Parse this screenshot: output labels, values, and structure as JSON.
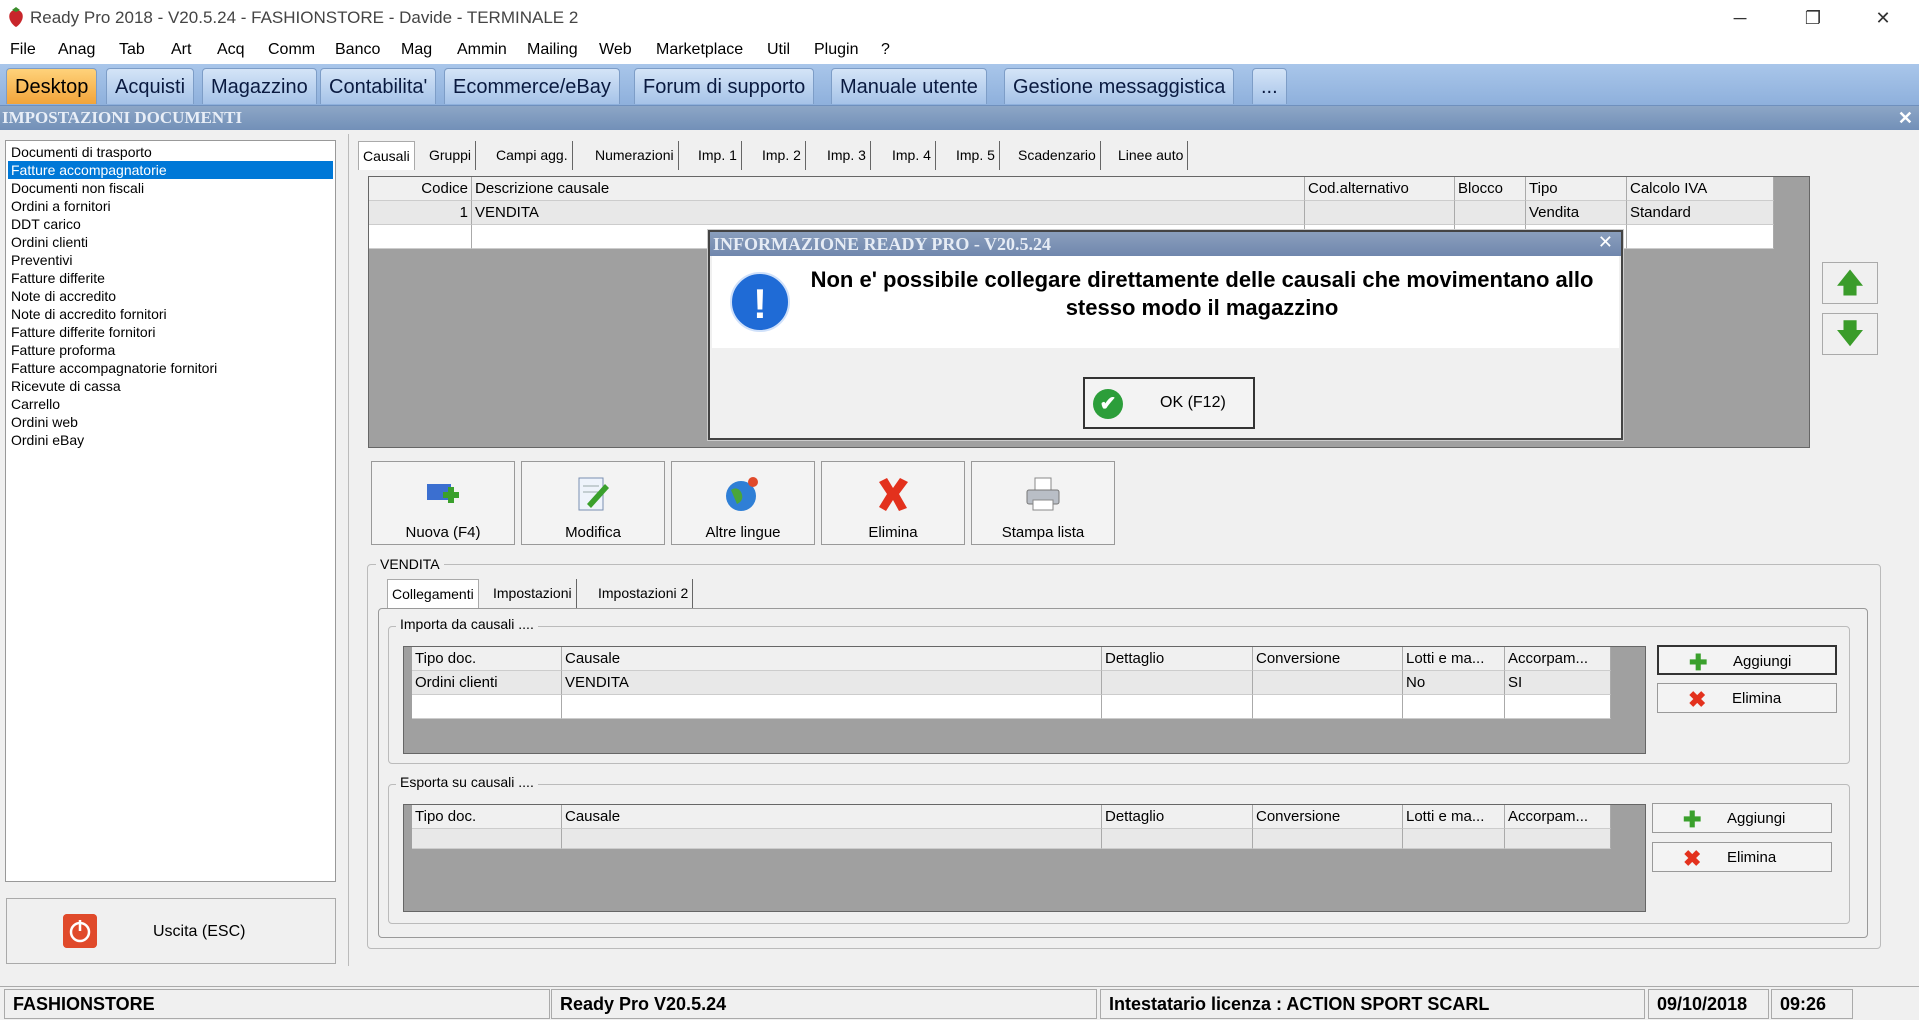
{
  "window": {
    "title": "Ready Pro 2018 - V20.5.24 - FASHIONSTORE - Davide - TERMINALE 2",
    "minimize_glyph": "─",
    "restore_glyph": "❐",
    "close_glyph": "✕"
  },
  "menu": [
    "File",
    "Anag",
    "Tab",
    "Art",
    "Acq",
    "Comm",
    "Banco",
    "Mag",
    "Ammin",
    "Mailing",
    "Web",
    "Marketplace",
    "Util",
    "Plugin",
    "?"
  ],
  "top_tabs": [
    "Desktop",
    "Acquisti",
    "Magazzino",
    "Contabilita'",
    "Ecommerce/eBay",
    "Forum di supporto",
    "Manuale utente",
    "Gestione messaggistica",
    "..."
  ],
  "section_title": "IMPOSTAZIONI DOCUMENTI",
  "section_close": "✕",
  "doc_types": [
    "Documenti di trasporto",
    "Fatture accompagnatorie",
    "Documenti non fiscali",
    "Ordini a fornitori",
    "DDT carico",
    "Ordini clienti",
    "Preventivi",
    "Fatture differite",
    "Note di accredito",
    "Note di accredito fornitori",
    "Fatture differite fornitori",
    "Fatture proforma",
    "Fatture accompagnatorie fornitori",
    "Ricevute di cassa",
    "Carrello",
    "Ordini web",
    "Ordini eBay"
  ],
  "exit_label": "Uscita (ESC)",
  "sub_tabs": [
    "Causali",
    "Gruppi",
    "Campi agg.",
    "Numerazioni",
    "Imp. 1",
    "Imp. 2",
    "Imp. 3",
    "Imp. 4",
    "Imp. 5",
    "Scadenzario",
    "Linee auto"
  ],
  "causali_grid": {
    "headers": [
      "Codice",
      "Descrizione causale",
      "Cod.alternativo",
      "Blocco",
      "Tipo",
      "Calcolo IVA"
    ],
    "rows": [
      [
        "1",
        "VENDITA",
        "",
        "",
        "Vendita",
        "Standard"
      ]
    ]
  },
  "arrows": {
    "up": "🡅",
    "down": "🡇"
  },
  "toolbar": [
    {
      "label": "Nuova (F4)",
      "icon": "new-icon"
    },
    {
      "label": "Modifica",
      "icon": "edit-icon"
    },
    {
      "label": "Altre lingue",
      "icon": "globe-icon"
    },
    {
      "label": "Elimina",
      "icon": "delete-icon"
    },
    {
      "label": "Stampa lista",
      "icon": "printer-icon"
    }
  ],
  "detail_title": "VENDITA",
  "detail_tabs": [
    "Collegamenti",
    "Impostazioni",
    "Impostazioni 2"
  ],
  "import_group": {
    "title": "Importa da causali ....",
    "headers": [
      "Tipo doc.",
      "Causale",
      "Dettaglio",
      "Conversione",
      "Lotti e ma...",
      "Accorpam..."
    ],
    "rows": [
      [
        "Ordini clienti",
        "VENDITA",
        "",
        "",
        "No",
        "SI"
      ]
    ],
    "add_label": "Aggiungi",
    "delete_label": "Elimina"
  },
  "export_group": {
    "title": "Esporta su causali ....",
    "headers": [
      "Tipo doc.",
      "Causale",
      "Dettaglio",
      "Conversione",
      "Lotti e ma...",
      "Accorpam..."
    ],
    "add_label": "Aggiungi",
    "delete_label": "Elimina"
  },
  "dialog": {
    "title": "INFORMAZIONE READY PRO - V20.5.24",
    "close": "✕",
    "icon_glyph": "!",
    "message": "Non e' possibile collegare direttamente delle causali che movimentano allo stesso modo il magazzino",
    "ok_label": "OK (F12)"
  },
  "status": {
    "company": "FASHIONSTORE",
    "version": "Ready Pro V20.5.24",
    "license": "Intestatario licenza : ACTION SPORT SCARL",
    "date": "09/10/2018",
    "time": "09:26"
  },
  "colors": {
    "accent": "#0078d7",
    "tab_active": "#f2a43a",
    "tabbar": "#9bbbe3",
    "header": "#7f9bc0"
  }
}
